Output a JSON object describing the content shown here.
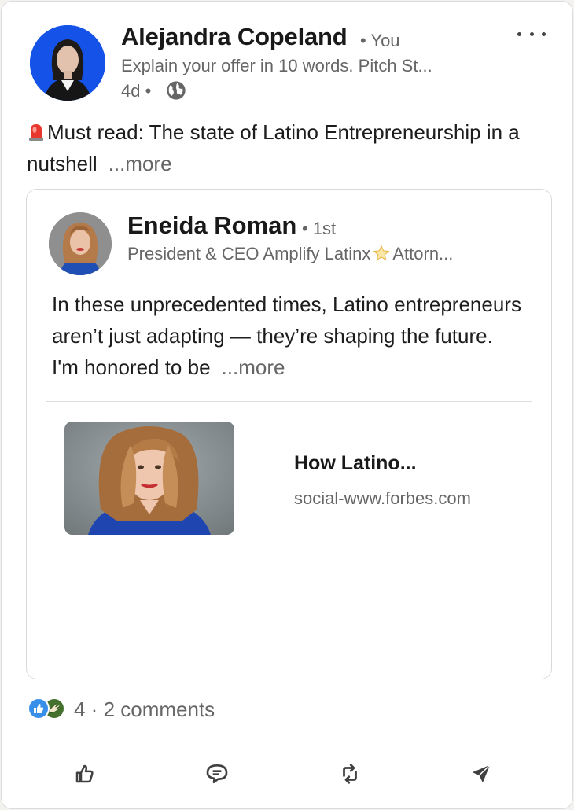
{
  "post": {
    "author_name": "Alejandra Copeland",
    "author_relation": "• You",
    "author_headline": "Explain your offer in 10 words. Pitch St...",
    "time": "4d •",
    "commentary": "Must read: The state of Latino Entrepreneurship in a nutshell",
    "more_label": "...more"
  },
  "reshared": {
    "author_name": "Eneida Roman",
    "degree": "• 1st",
    "headline_part1": "President & CEO Amplify Latinx",
    "headline_part2": "Attorn...",
    "text": "In these unprecedented times, Latino entrepreneurs aren’t just adapting — they’re shaping the future. I'm honored to be",
    "more_label": "...more",
    "article": {
      "title": "How Latino...",
      "source": "social-www.forbes.com"
    }
  },
  "social": {
    "counts_text": "4 · 2 comments"
  },
  "icons": {
    "globe": "globe-icon",
    "more": "more-options-icon",
    "siren": "rotating-light-emoji",
    "star": "star-emoji",
    "like": "like-icon",
    "comment": "comment-icon",
    "repost": "repost-icon",
    "send": "send-icon"
  },
  "colors": {
    "reaction_like": "#378fe9",
    "reaction_support": "#44712e",
    "muted_text": "#666666"
  }
}
